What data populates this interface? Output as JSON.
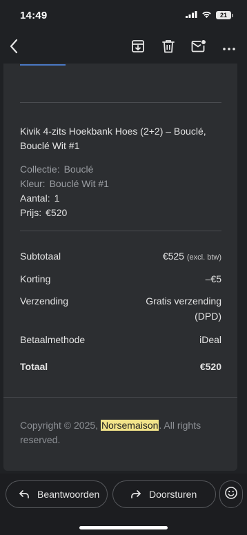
{
  "status_bar": {
    "time": "14:49",
    "battery": "21",
    "icons": [
      "signal-icon",
      "wifi-icon",
      "battery-icon"
    ]
  },
  "toolbar": {
    "back_icon": "chevron-left-icon",
    "actions": [
      "archive-icon",
      "trash-icon",
      "mark-unread-icon",
      "more-icon"
    ]
  },
  "order": {
    "product_title": "Kivik 4-zits Hoekbank Hoes (2+2) – Bouclé, Bouclé Wit #1",
    "collection_label": "Collectie:",
    "collection_value": "Bouclé",
    "color_label": "Kleur:",
    "color_value": "Bouclé Wit #1",
    "quantity_label": "Aantal:",
    "quantity_value": "1",
    "price_label": "Prijs:",
    "price_value": "€520"
  },
  "summary": {
    "subtotal_label": "Subtotaal",
    "subtotal_value": "€525",
    "subtotal_note": "(excl. btw)",
    "discount_label": "Korting",
    "discount_value": "–€5",
    "shipping_label": "Verzending",
    "shipping_value_line1": "Gratis verzending",
    "shipping_value_line2": "(DPD)",
    "payment_label": "Betaalmethode",
    "payment_value": "iDeal",
    "total_label": "Totaal",
    "total_value": "€520"
  },
  "footer": {
    "copyright_prefix": "Copyright © 2025, ",
    "brand": "Norsemaison",
    "copyright_suffix": ". All rights reserved."
  },
  "actions": {
    "reply_label": "Beantwoorden",
    "forward_label": "Doorsturen",
    "reply_icon": "reply-icon",
    "forward_icon": "forward-icon",
    "emoji_icon": "emoji-icon"
  }
}
